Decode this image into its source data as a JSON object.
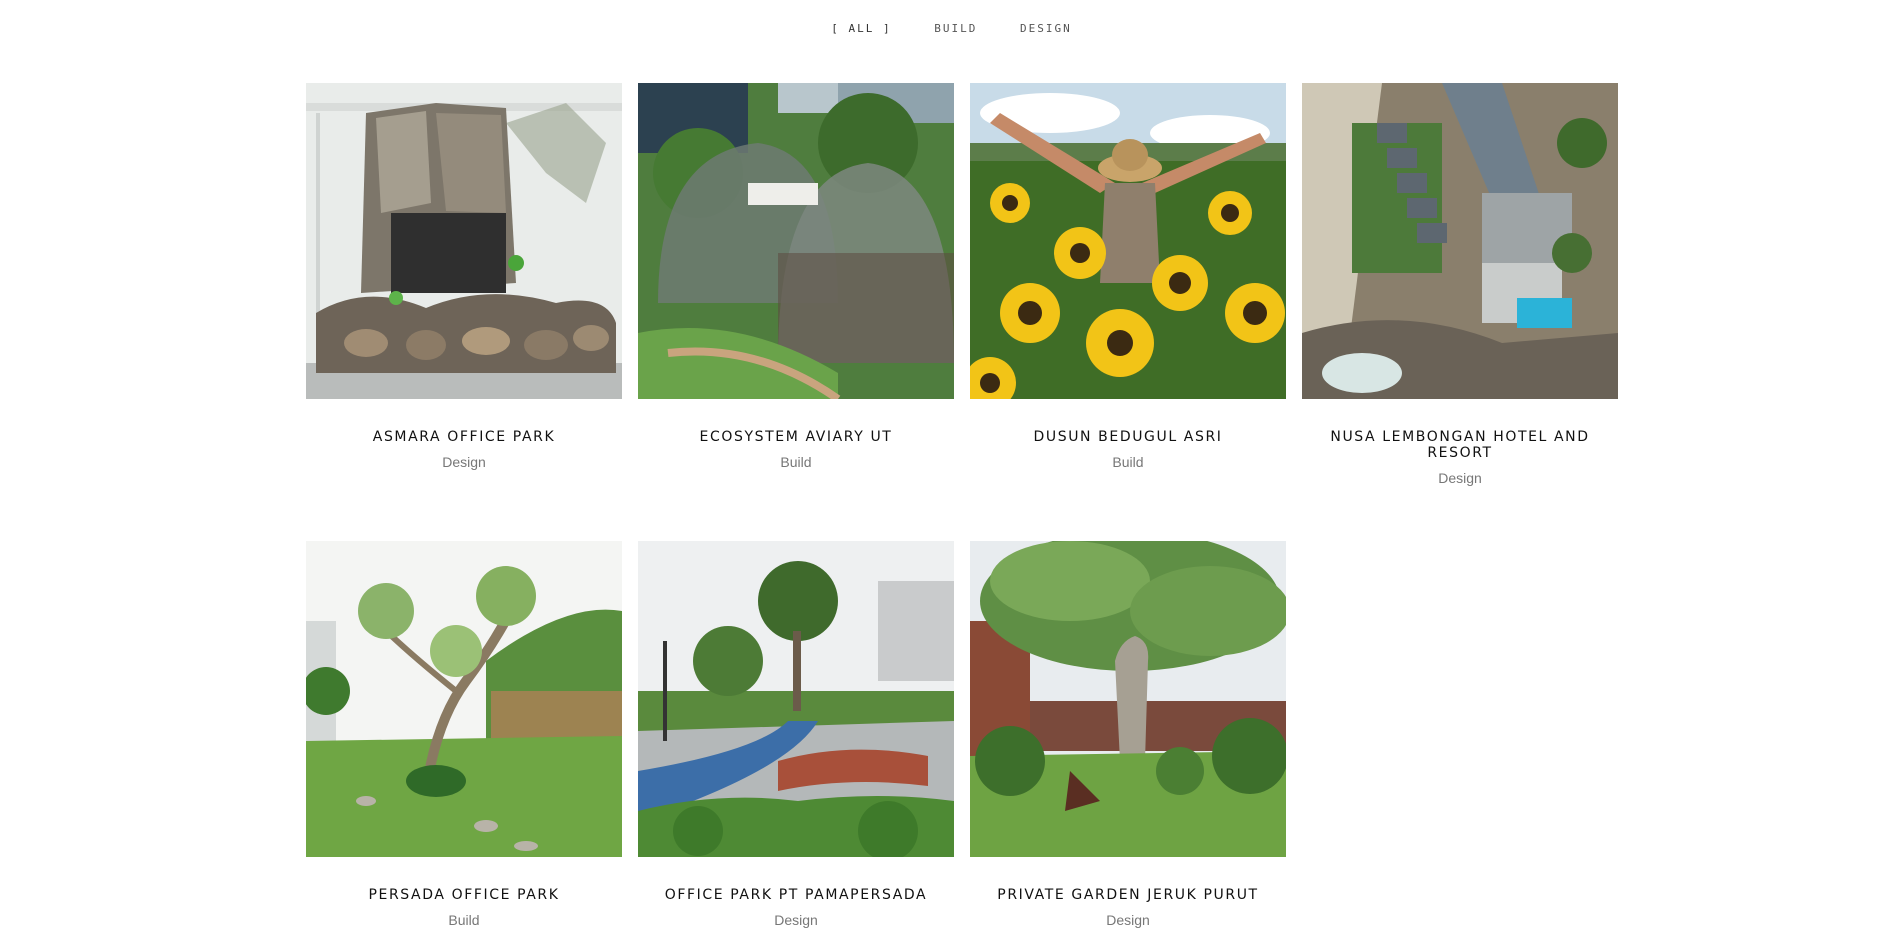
{
  "filters": {
    "all": "[ ALL ]",
    "build": "BUILD",
    "design": "DESIGN"
  },
  "projects": [
    {
      "title": "ASMARA OFFICE PARK",
      "category": "Design",
      "image": "stone-fountain"
    },
    {
      "title": "ECOSYSTEM AVIARY UT",
      "category": "Build",
      "image": "aviary-domes"
    },
    {
      "title": "DUSUN BEDUGUL ASRI",
      "category": "Build",
      "image": "sunflower-field"
    },
    {
      "title": "NUSA LEMBONGAN HOTEL AND RESORT",
      "category": "Design",
      "image": "resort-aerial"
    },
    {
      "title": "PERSADA OFFICE PARK",
      "category": "Build",
      "image": "garden-tree-lawn"
    },
    {
      "title": "OFFICE PARK PT PAMAPERSADA",
      "category": "Design",
      "image": "park-bench-path"
    },
    {
      "title": "PRIVATE GARDEN JERUK PURUT",
      "category": "Design",
      "image": "big-tree-garden"
    }
  ]
}
